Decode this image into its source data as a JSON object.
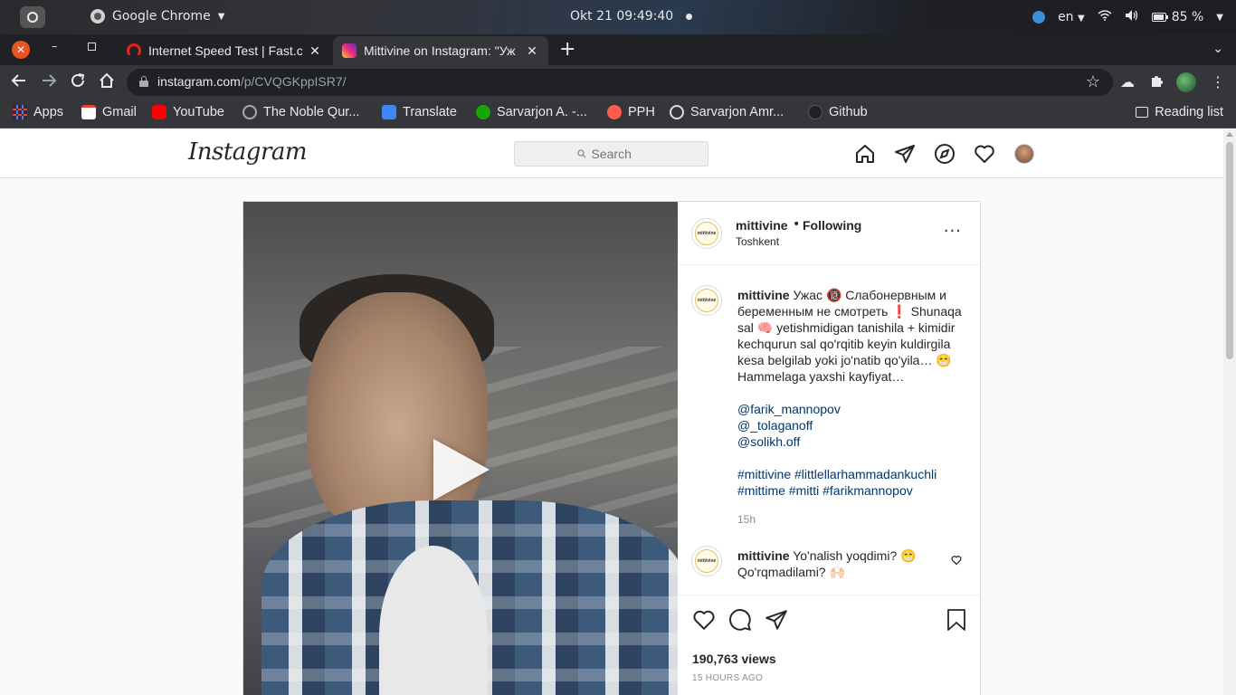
{
  "os_bar": {
    "app_name": "Google Chrome",
    "clock": "Okt 21  09:49:40",
    "language": "en",
    "battery": "85 %"
  },
  "tabs": [
    {
      "title": "Internet Speed Test | Fast.com",
      "icon": "speed-gauge-icon",
      "close": "✕"
    },
    {
      "title": "Mittivine on Instagram: \"Уж",
      "icon": "instagram-icon",
      "close": "✕"
    }
  ],
  "new_tab": "+",
  "window_controls": {
    "close": "✕",
    "minimize": "–"
  },
  "address_bar": {
    "host": "instagram.com",
    "path": "/p/CVQGKppISR7/"
  },
  "bookmarks": [
    {
      "label": "Apps",
      "icon": "apps-grid-icon"
    },
    {
      "label": "Gmail",
      "icon": "gmail-icon"
    },
    {
      "label": "YouTube",
      "icon": "youtube-icon"
    },
    {
      "label": "The Noble Qur...",
      "icon": "quran-icon"
    },
    {
      "label": "Translate",
      "icon": "google-translate-icon"
    },
    {
      "label": "Sarvarjon A. -...",
      "icon": "upwork-icon"
    },
    {
      "label": "PPH",
      "icon": "pph-icon"
    },
    {
      "label": "Sarvarjon Amr...",
      "icon": "globe-icon"
    },
    {
      "label": "Github",
      "icon": "github-icon"
    }
  ],
  "reading_list": "Reading list",
  "instagram": {
    "logo": "Instagram",
    "search_placeholder": "Search",
    "post": {
      "username": "mittivine",
      "separator": "•",
      "follow_status": "Following",
      "location": "Toshkent",
      "more": "···",
      "avatar_text": "mittivine",
      "caption": {
        "username": "mittivine",
        "text": "Ужас 🔞 Слабонервным и беременным не смотреть ❗ Shunaqa sal 🧠 yetishmidigan tanishila + kimidir kechqurun sal qo'rqitib keyin kuldirgila kesa belgilab yoki jo'natib qo'yila… 😁 Hammelaga yaxshi kayfiyat…",
        "mentions": [
          "@farik_mannopov",
          "@_tolaganoff",
          "@solikh.off"
        ],
        "hashtags_line1": "#mittivine #littlellarhammadankuchli",
        "hashtags_line2": "#mittime #mitti #farikmannopov",
        "time": "15h"
      },
      "comment": {
        "username": "mittivine",
        "text": "Yo'nalish yoqdimi? 😁 Qo'rqmadilami? 🙌🏻"
      },
      "views": "190,763 views",
      "posted_ago": "15 HOURS AGO"
    }
  }
}
